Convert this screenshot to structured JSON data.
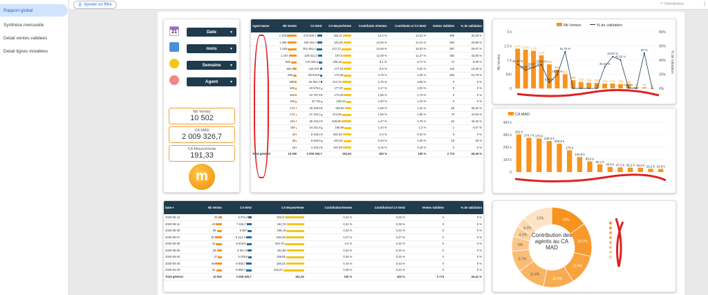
{
  "nav": {
    "items": [
      "Rapport global",
      "Synthèse mensuelle",
      "Detail ventes validées",
      "Detail lignes installées"
    ]
  },
  "topbar": {
    "filter_label": "Ajouter un filtre",
    "reset_label": "Réinitialiser",
    "menu": "⋮"
  },
  "controls": {
    "calendar_day": "21",
    "dropdowns": [
      "Date",
      "mois",
      "Semaine",
      "Agent"
    ]
  },
  "kpis": [
    {
      "label": "Nb Ventes",
      "value": "10 502"
    },
    {
      "label": "CA MAD",
      "value": "2 009 326,7"
    },
    {
      "label": "CA Moyen/Vente",
      "value": "191,33"
    }
  ],
  "logo_text": "m",
  "agent_table": {
    "headers": [
      "Agent Name",
      "Nb Ventes",
      "CA MAD",
      "CA Moyen/Vente",
      "Contributio n/Ventes",
      "Contributio n/ CA MAD",
      "Ventes Validées",
      "% de validation"
    ],
    "rows": [
      [
        "",
        "1 403",
        "270 048,7",
        "192,21",
        "13,4 %",
        "13,44 %",
        "486",
        "34,28 %"
      ],
      [
        "",
        "1 369",
        "249 324,7",
        "182,25",
        "13,05 %",
        "12,41 %",
        "354",
        "25,86 %"
      ],
      [
        "",
        "1 328",
        "301 962,4",
        "227,27",
        "12,68 %",
        "15,03 %",
        "397",
        "29,87 %"
      ],
      [
        "",
        "1 167",
        "228 511,3",
        "197,5",
        "11,09 %",
        "11,37 %",
        "392",
        "33,69 %"
      ],
      [
        "",
        "849",
        "175 028,3",
        "206,16",
        "8,1 %",
        "8,71 %",
        "72",
        "8,48 %"
      ],
      [
        "",
        "662",
        "120 870",
        "177,23",
        "6,5 %",
        "6,02 %",
        "132",
        "19,35 %"
      ],
      [
        "",
        "502",
        "85 515,6",
        "170,36",
        "4,79 %",
        "4,26 %",
        "260",
        "51,79 %"
      ],
      [
        "",
        "289",
        "62 052,7",
        "214,72",
        "2,76 %",
        "3,09 %",
        "0",
        "0 %"
      ],
      [
        "",
        "228",
        "40 575,4",
        "177,97",
        "2,17 %",
        "2,02 %",
        "0",
        "0 %"
      ],
      [
        "",
        "204",
        "34 797,8",
        "170,43",
        "1,95 %",
        "1,73 %",
        "0",
        "0 %"
      ],
      [
        "",
        "192",
        "24 702",
        "128,52",
        "1,83 %",
        "1,23 %",
        "0",
        "0 %"
      ],
      [
        "",
        "174",
        "26 246,9",
        "150,84",
        "1,66 %",
        "1,31 %",
        "56",
        "30,32 %"
      ],
      [
        "",
        "174",
        "37 234,4",
        "213,99",
        "1,66 %",
        "1,85 %",
        "79",
        "44,83 %"
      ],
      [
        "",
        "154",
        "35 244,2",
        "228,86",
        "1,47 %",
        "1,75 %",
        "62",
        "40,26 %"
      ],
      [
        "",
        "150",
        "24 151,8",
        "160,88",
        "1,43 %",
        "1,2 %",
        "1",
        "0,67 %"
      ],
      [
        "",
        "42",
        "8 348,4",
        "200,33",
        "0,4 %",
        "0,43 %",
        "0",
        "0 %"
      ],
      [
        "",
        "36",
        "6 633,5",
        "184,32",
        "0,34 %",
        "0,33 %",
        "18",
        "50 %"
      ],
      [
        "",
        "16",
        "3 153,4",
        "197,09",
        "0,15 %",
        "0,16 %",
        "0",
        "0 %"
      ]
    ],
    "total": [
      "Total général",
      "10 400",
      "2 009 326,7",
      "191,64",
      "100 %",
      "100 %",
      "2 774",
      "26,46 %"
    ]
  },
  "date_table": {
    "headers": [
      "Date ▾",
      "Nb Ventes",
      "CA MAD",
      "CA Moyen/Vente",
      "Contribution/Ventes",
      "Contribution/ CA MAD",
      "Ventes Validées",
      "% de validation"
    ],
    "rows": [
      [
        "2020-05-12",
        "25",
        "5 072,4",
        "202,9",
        "0,24 %",
        "0,25 %",
        "0",
        "0 %"
      ],
      [
        "2020-05-11",
        "43",
        "7 816,7",
        "181,78",
        "0,41 %",
        "0,39 %",
        "0",
        "0 %"
      ],
      [
        "2020-05-08",
        "36",
        "6 667",
        "185,19",
        "0,34 %",
        "0,33 %",
        "0",
        "0 %"
      ],
      [
        "2020-05-07",
        "49",
        "9 412,4",
        "192,09",
        "0,47 %",
        "0,47 %",
        "0",
        "0 %"
      ],
      [
        "2020-05-06",
        "42",
        "8 519,5",
        "202,78",
        "0,4 %",
        "0,42 %",
        "0",
        "0 %"
      ],
      [
        "2020-05-05",
        "36",
        "6 547,3",
        "181,86",
        "0,34 %",
        "0,33 %",
        "0",
        "0 %"
      ],
      [
        "2020-05-04",
        "27",
        "5 039,8",
        "186,66",
        "0,26 %",
        "0,25 %",
        "0",
        "0 %"
      ],
      [
        "2020-04-30",
        "46",
        "8 658,7",
        "188,23",
        "0,44 %",
        "0,43 %",
        "0",
        "0 %"
      ],
      [
        "2020-04-29",
        "41",
        "8 858,7",
        "216,07",
        "0,39 %",
        "0,44 %",
        "0",
        "0 %"
      ]
    ],
    "total": [
      "Total général",
      "10 502",
      "2 009 326,7",
      "191,33",
      "100 %",
      "100 %",
      "2 774",
      "26,41 %"
    ]
  },
  "chart_data": [
    {
      "type": "bar",
      "series": [
        {
          "name": "Nb Ventes",
          "values": [
            1403,
            1369,
            1328,
            1167,
            849,
            662,
            502,
            289,
            228,
            204,
            192,
            174,
            174,
            154,
            150,
            42,
            36,
            16
          ]
        },
        {
          "name": "% de validation",
          "values": [
            34.28,
            25.86,
            29.87,
            33.69,
            8.48,
            19.35,
            51.79,
            0,
            0,
            0,
            0,
            30.32,
            44.83,
            40.26,
            0.67,
            0,
            50,
            0
          ]
        }
      ],
      "data_labels": [
        "1,4 k",
        "1,4 k",
        "1,3 k",
        "1,2 k",
        "849",
        "662",
        "502",
        "289",
        "228",
        "204",
        "192",
        "174",
        "174",
        "154",
        "150",
        "42",
        "36",
        "16"
      ],
      "pct_labels": [
        "34,28 %",
        "25,86 %",
        "29,87 %",
        "33,69 %",
        "8,48 %",
        "19,35 %",
        "51,79 %",
        "0 %",
        "0 %",
        "0 %",
        "0 %",
        "30,32 %",
        "44,83 %",
        "40,26 %",
        "0,67 %",
        "0 %",
        "50 %",
        "0 %"
      ],
      "ylabel": "Nb Ventes",
      "y2label": "% de validation",
      "yticks": [
        "0",
        "500",
        "1 k",
        "1,5 k",
        "2 k"
      ],
      "y2ticks": [
        "0%",
        "20%",
        "40%",
        "60%",
        "80%"
      ],
      "ylim": [
        0,
        2000
      ],
      "y2lim": [
        0,
        80
      ],
      "legend": "top",
      "colors": {
        "bars": "#f7931e",
        "line": "#1f3b4d"
      }
    },
    {
      "type": "bar",
      "series": [
        {
          "name": "CA MAD",
          "values": [
            302000,
            274700,
            270000,
            249300,
            228500,
            175000,
            120900,
            85500,
            62100,
            40600,
            37200,
            35200,
            34600,
            26200,
            24800
          ]
        }
      ],
      "data_labels": [
        "302 k",
        "274,7 k",
        "270 k",
        "249,3 k",
        "228,5 k",
        "175 k",
        "120,9 k",
        "85,5 k",
        "62,1 k",
        "40,6 k",
        "37,2 k",
        "35,2 k",
        "34,6 k",
        "26,2 k",
        "24,8 k"
      ],
      "yticks": [
        "0",
        "100 k",
        "200 k",
        "300 k",
        "400 k"
      ],
      "ylim": [
        0,
        400000
      ],
      "legend": "top",
      "colors": {
        "bars": "#f7931e"
      }
    },
    {
      "type": "pie",
      "center_title": "Contribution des agents au CA MAD",
      "values": [
        15.0,
        13.7,
        12.4,
        12.4,
        11.4,
        8.7,
        6.0,
        4.3,
        4.3,
        12.0
      ],
      "labels": [
        "15%",
        "13.7%",
        "12.4%",
        "12.4%",
        "11.4%",
        "8.7%",
        "6%",
        "4.3%",
        "4.3%",
        "12%"
      ],
      "colors": [
        "#f7931e",
        "#f89a2e",
        "#f9a33f",
        "#faab51",
        "#fbb463",
        "#fbbd76",
        "#fcc689",
        "#fdd09d",
        "#fdd9b1",
        "#fde2c4"
      ]
    }
  ]
}
